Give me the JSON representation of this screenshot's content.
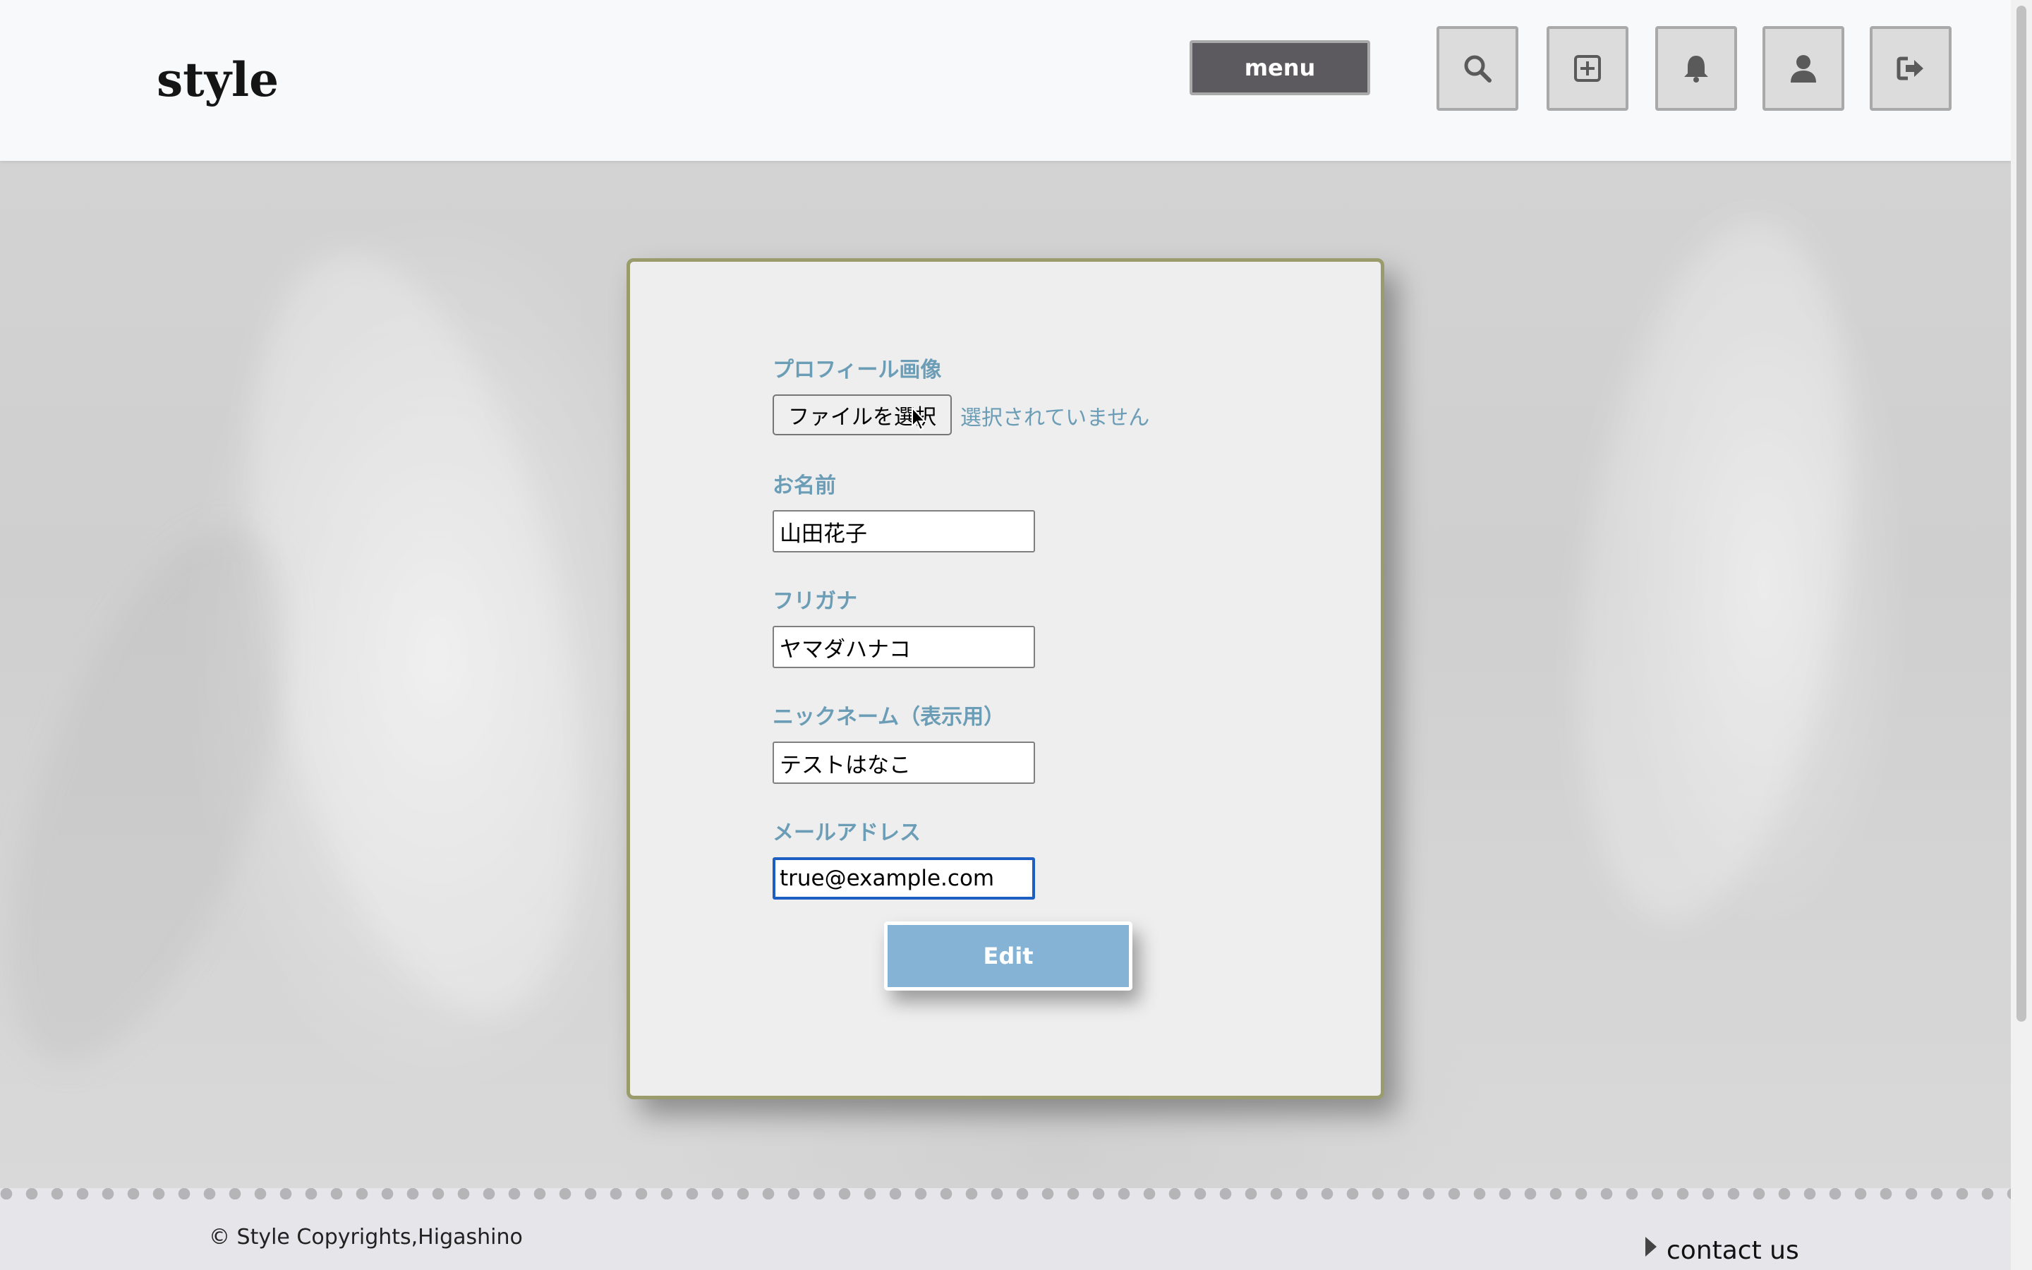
{
  "header": {
    "logo": "style",
    "menu_label": "menu",
    "icons": [
      "search-icon",
      "add-post-icon",
      "bell-icon",
      "user-icon",
      "logout-icon"
    ]
  },
  "form": {
    "profile_image_label": "プロフィール画像",
    "file_button_label": "ファイルを選択",
    "file_status": "選択されていません",
    "name_label": "お名前",
    "name_value": "山田花子",
    "furigana_label": "フリガナ",
    "furigana_value": "ヤマダハナコ",
    "nickname_label": "ニックネーム（表示用）",
    "nickname_value": "テストはなこ",
    "email_label": "メールアドレス",
    "email_value": "true@example.com",
    "submit_label": "Edit"
  },
  "footer": {
    "copyright": "© Style Copyrights,Higashino",
    "contact_label": "contact us"
  },
  "colors": {
    "label_blue": "#6b9db6",
    "edit_button": "#85b3d6",
    "card_border": "#9a9c6c",
    "menu_button": "#5d5a5f",
    "focus_ring": "#1c5ec1"
  }
}
